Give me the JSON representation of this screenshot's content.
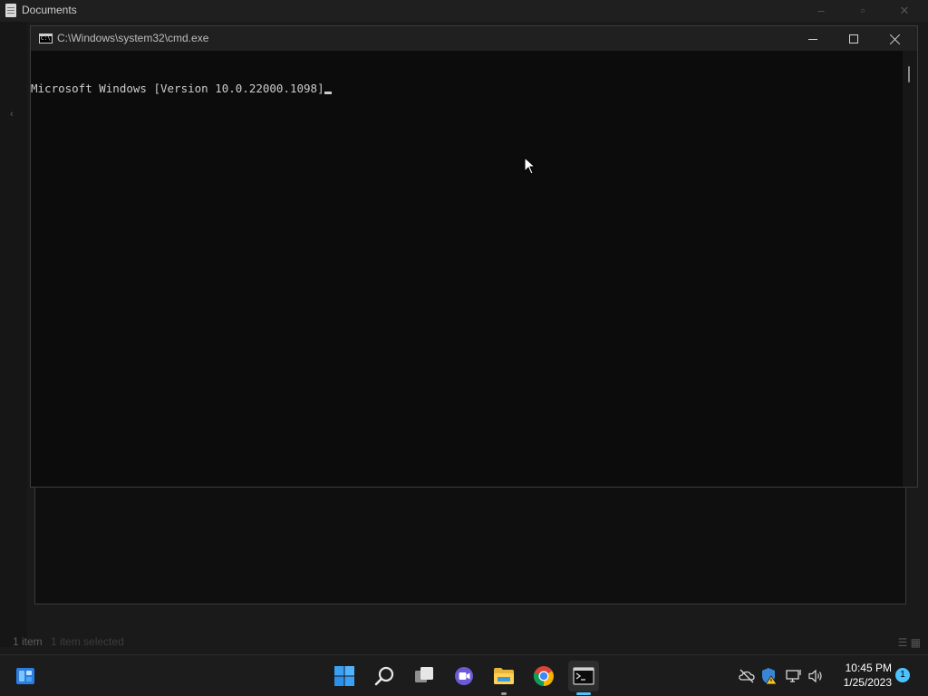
{
  "explorer": {
    "title": "Documents",
    "status_text": "1 item",
    "status_extra": "1 item selected"
  },
  "cmd": {
    "title": "C:\\Windows\\system32\\cmd.exe",
    "lines": [
      "Microsoft Windows [Version 10.0.22000.1098]"
    ]
  },
  "taskbar": {
    "icons": [
      "widgets-icon",
      "start-icon",
      "search-icon",
      "task-view-icon",
      "chat-icon",
      "file-explorer-icon",
      "chrome-icon",
      "cmd-icon"
    ],
    "time": "10:45 PM",
    "date": "1/25/2023",
    "notification_count": "1"
  },
  "colors": {
    "accent": "#4cc2ff",
    "console_bg": "#0c0c0c",
    "console_fg": "#cccccc",
    "taskbar_bg": "#1c1c1c"
  }
}
